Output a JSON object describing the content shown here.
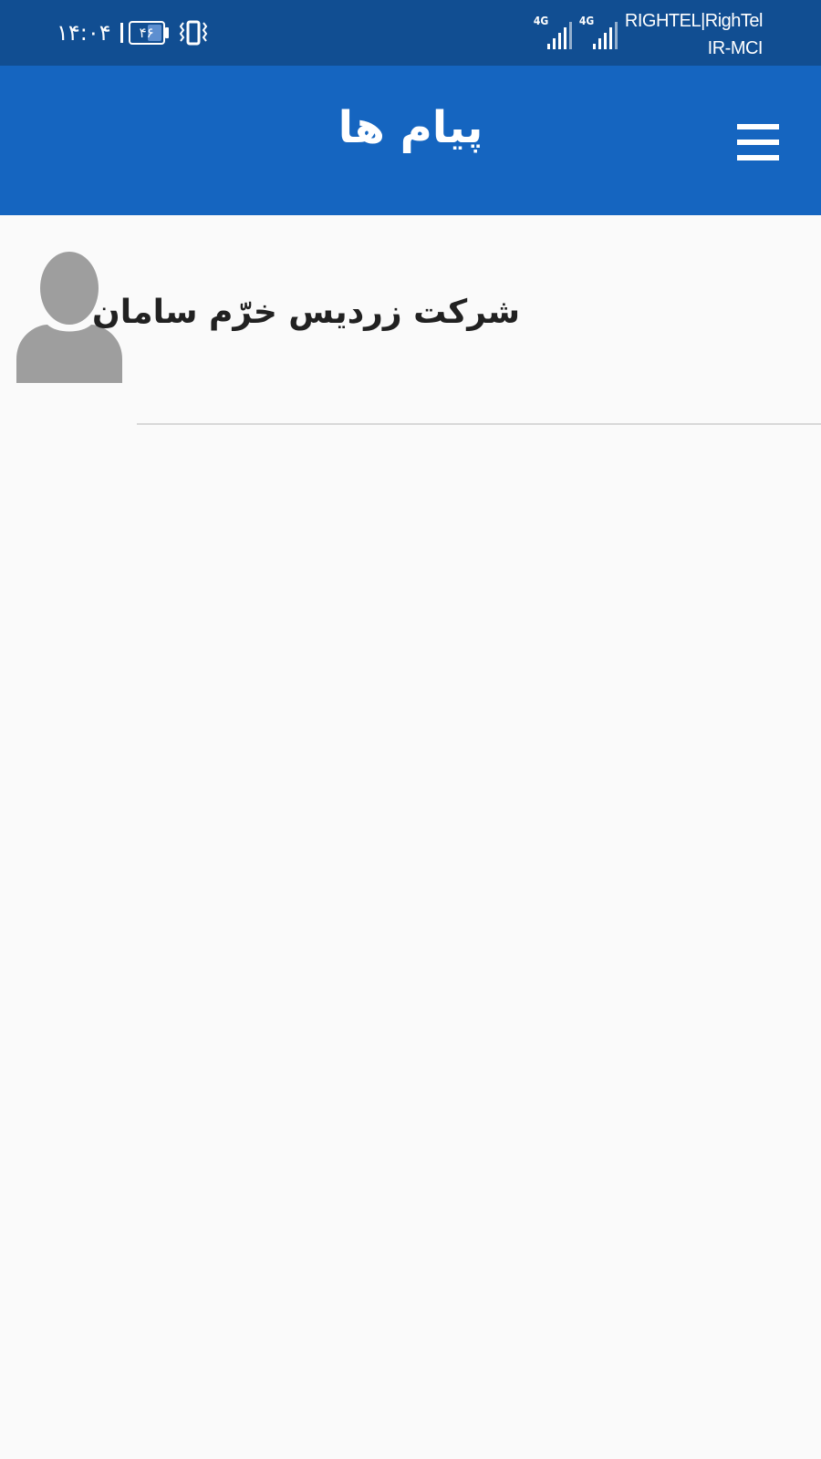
{
  "status_bar": {
    "time": "۱۴:۰۴",
    "battery_level": "۴۶",
    "battery_fraction": 0.46,
    "carriers": [
      "RIGHTEL|RighTel",
      "IR-MCI"
    ],
    "signals": [
      {
        "network_type": "4G",
        "icon": "signal-icon"
      },
      {
        "network_type": "4G",
        "icon": "signal-icon"
      }
    ],
    "vibrate_icon": "vibrate-icon"
  },
  "app_bar": {
    "title": "پیام ها",
    "menu_icon": "hamburger-menu-icon"
  },
  "conversations": [
    {
      "title": "شرکت زردیس خرّم سامان",
      "avatar_icon": "person-avatar-icon"
    }
  ],
  "colors": {
    "status_bar": "#114e92",
    "app_bar": "#1565c0",
    "background": "#fafafa",
    "avatar": "#9e9e9e",
    "divider": "#d8d8d8",
    "text": "#212121"
  }
}
